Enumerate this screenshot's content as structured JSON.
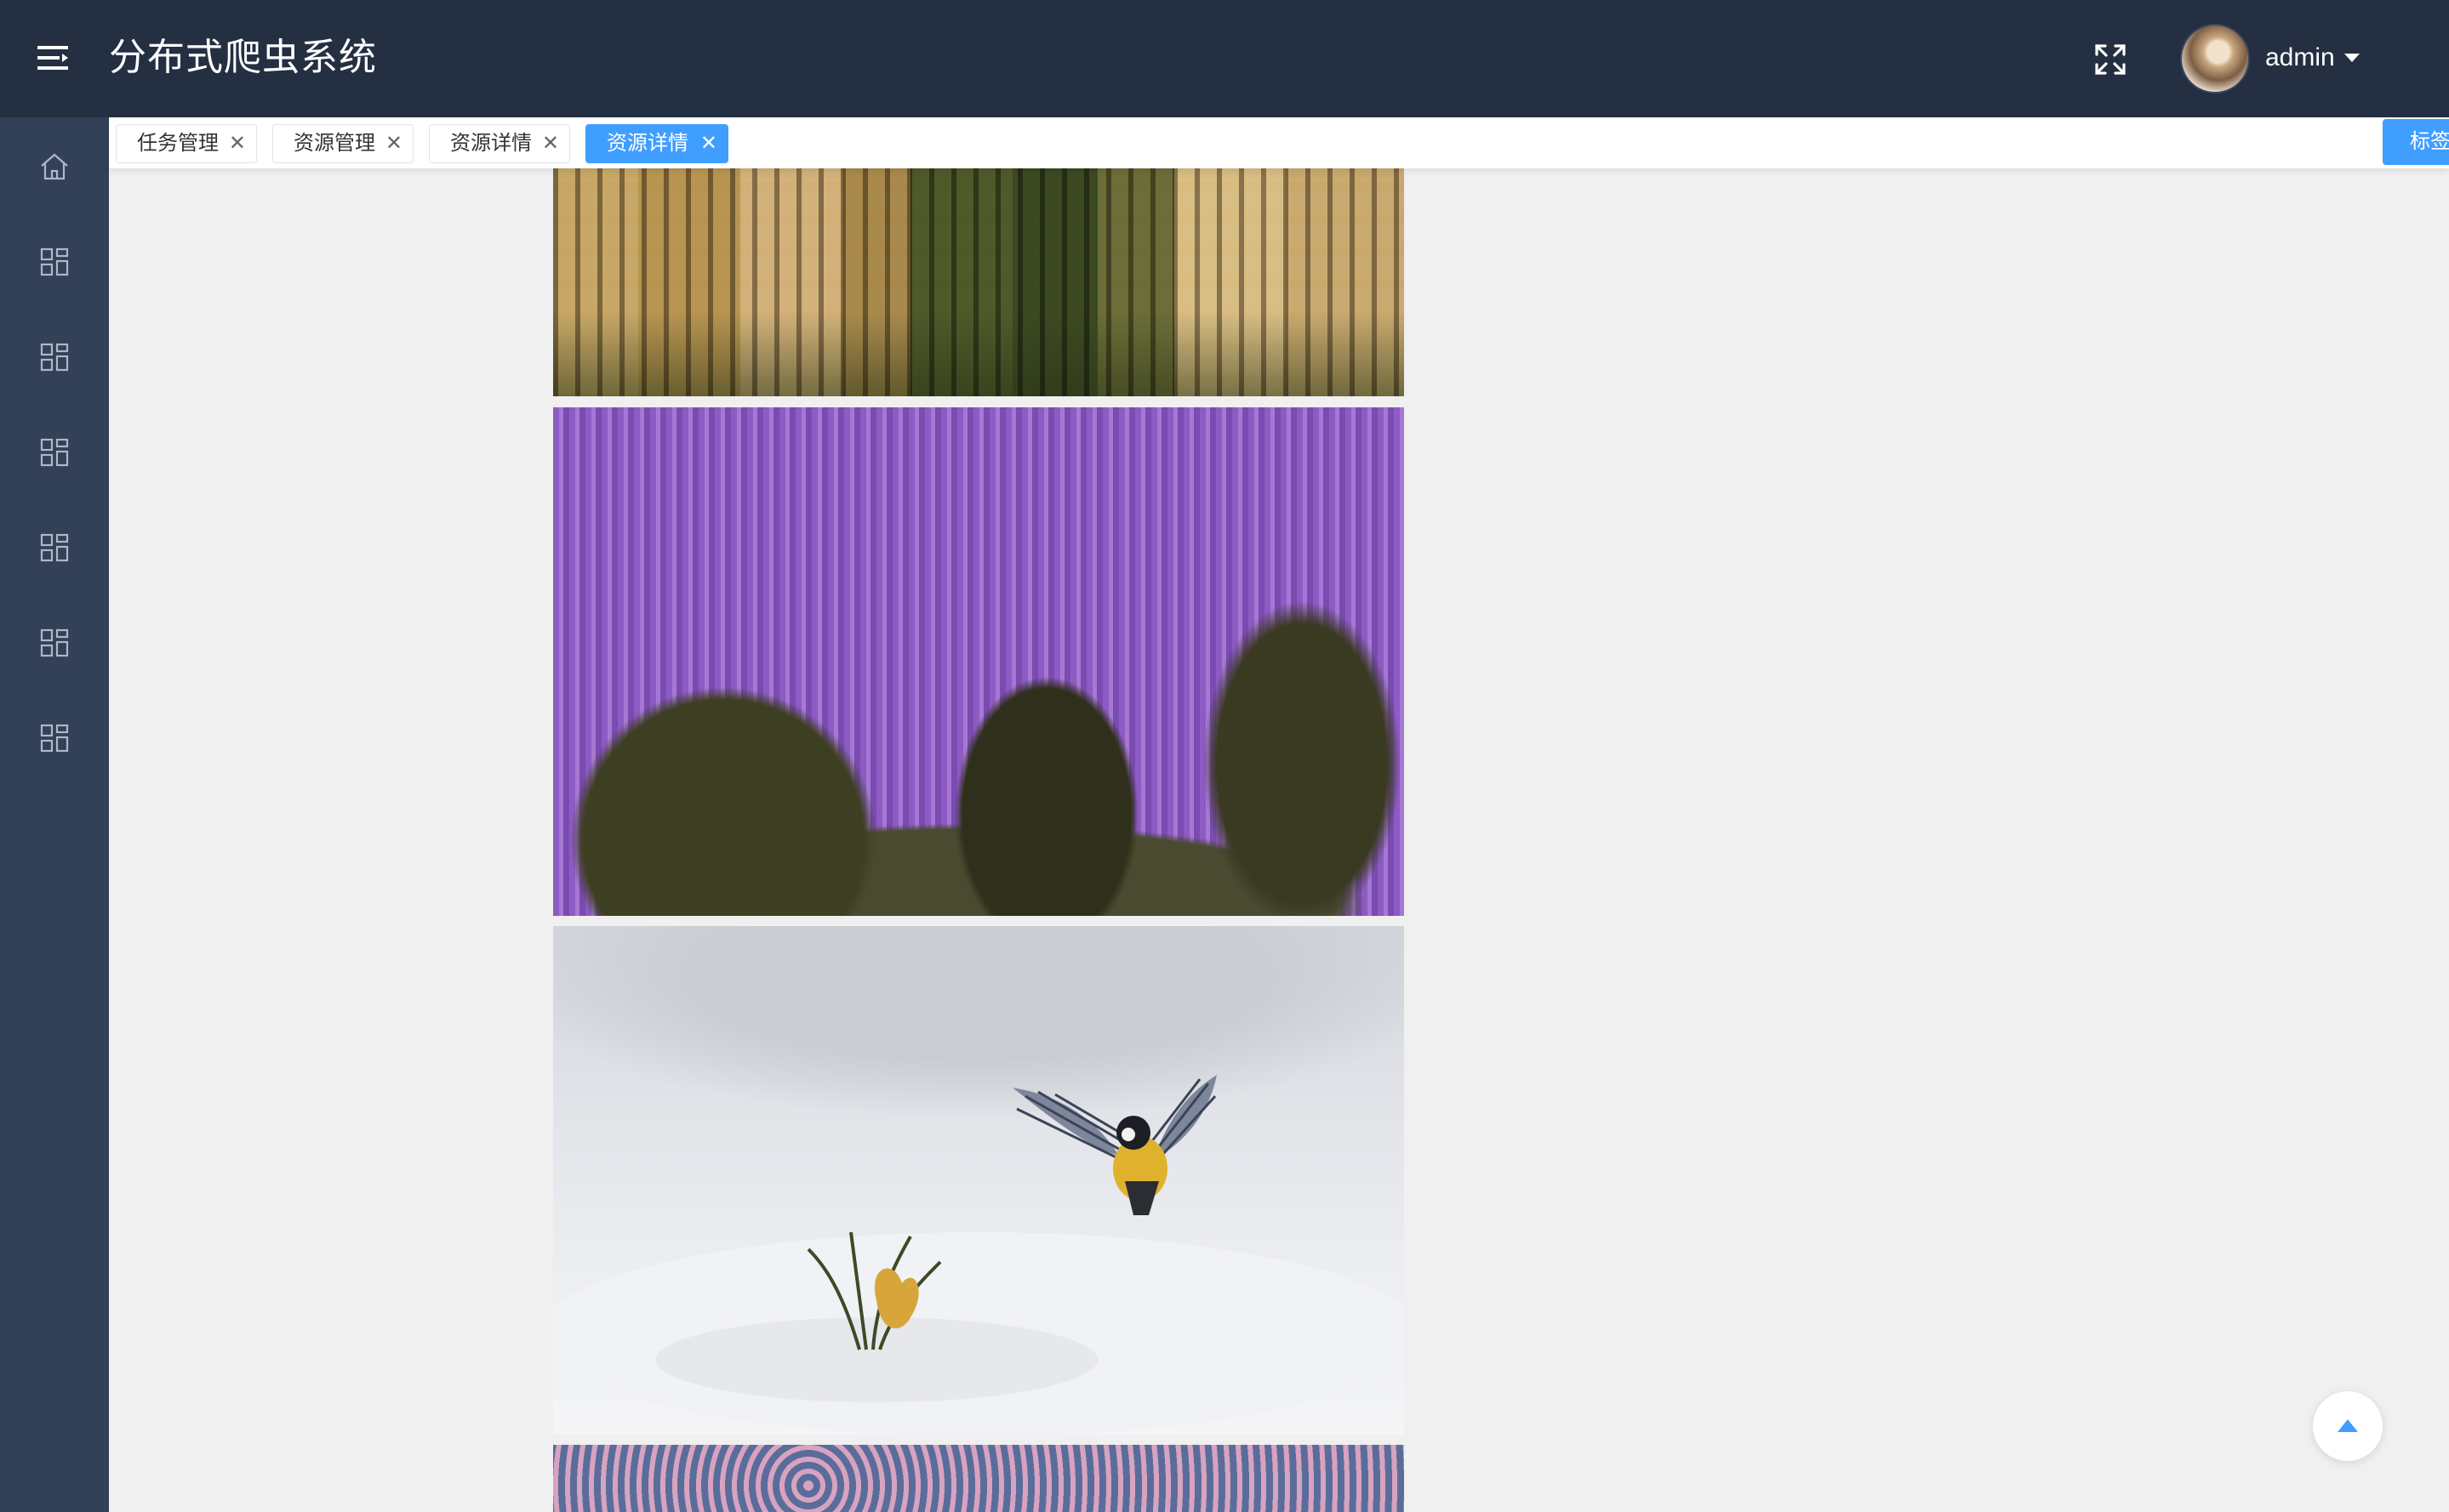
{
  "header": {
    "app_title": "分布式爬虫系统",
    "user_name": "admin",
    "menu_toggle_icon": "hamburger-menu-icon",
    "fullscreen_icon": "fullscreen-icon",
    "user_dropdown_icon": "caret-down-icon",
    "background_color": "#242f42"
  },
  "sidebar": {
    "background_color": "#324157",
    "items": [
      {
        "icon": "home-icon"
      },
      {
        "icon": "grid-icon"
      },
      {
        "icon": "grid-icon"
      },
      {
        "icon": "grid-icon"
      },
      {
        "icon": "grid-icon"
      },
      {
        "icon": "grid-icon"
      },
      {
        "icon": "grid-icon"
      }
    ]
  },
  "tags": {
    "items": [
      {
        "label": "任务管理",
        "active": false
      },
      {
        "label": "资源管理",
        "active": false
      },
      {
        "label": "资源详情",
        "active": false
      },
      {
        "label": "资源详情",
        "active": true
      }
    ],
    "options_label": "标签选项",
    "accent_color": "#409eff"
  },
  "content": {
    "images": [
      {
        "subject": "parisian-buildings-photo"
      },
      {
        "subject": "purple-wisteria-photo"
      },
      {
        "subject": "bird-over-snow-photo"
      },
      {
        "subject": "cherry-blossom-photo"
      }
    ]
  },
  "back_to_top": {
    "icon": "arrow-up-icon"
  }
}
